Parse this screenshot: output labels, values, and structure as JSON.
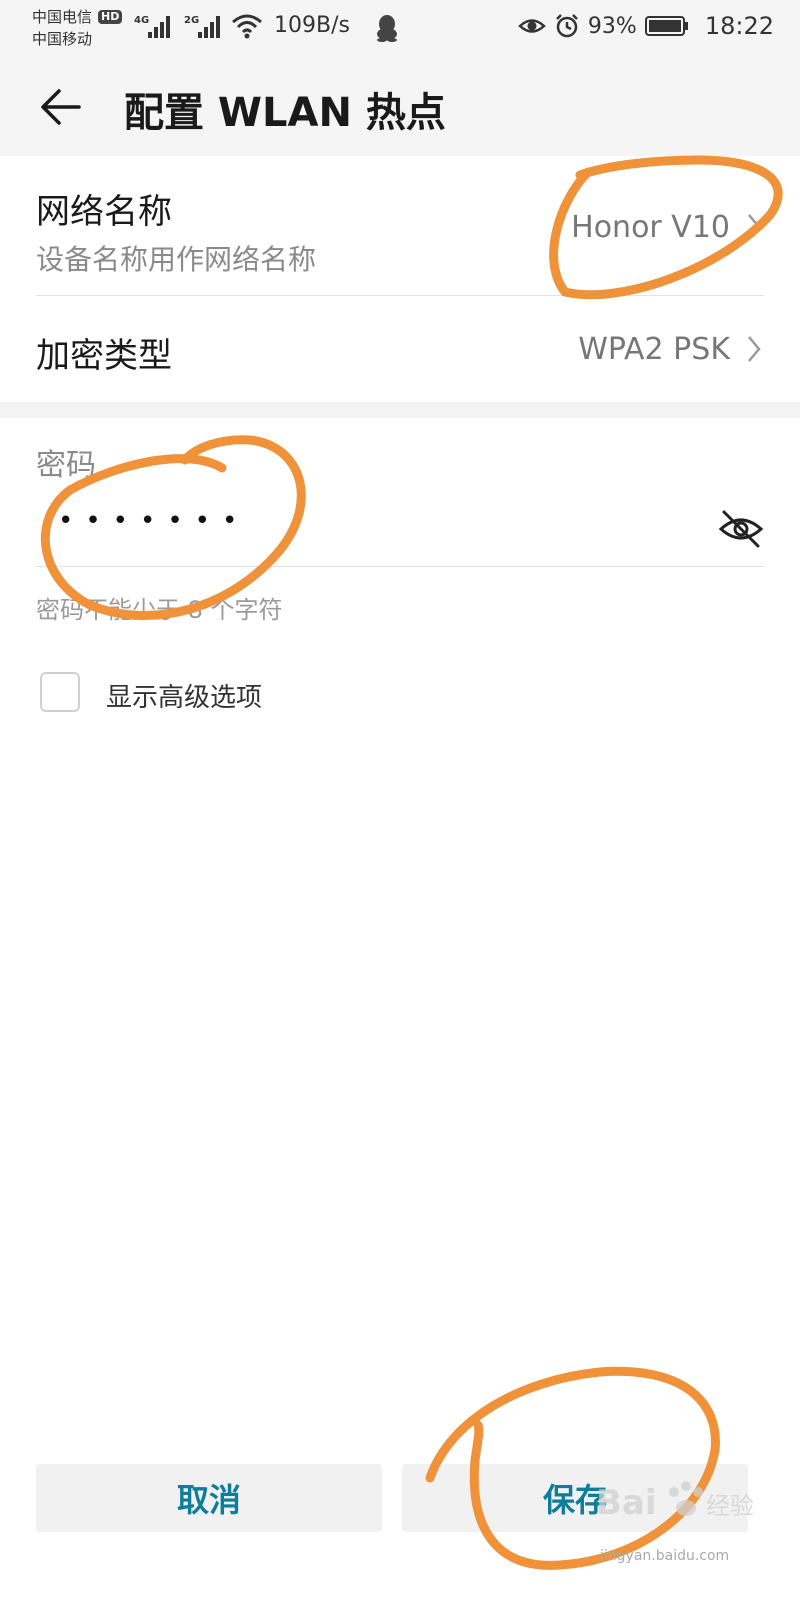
{
  "status_bar": {
    "carrier_1": "中国电信",
    "hd_badge": "HD",
    "carrier_2": "中国移动",
    "net_speed": "109B/s",
    "battery": "93%",
    "time": "18:22",
    "icons": [
      "signal-4g-icon",
      "signal-2g-icon",
      "wifi-icon",
      "qq-icon",
      "eye-icon",
      "alarm-icon",
      "battery-icon"
    ]
  },
  "toolbar": {
    "title": "配置 WLAN 热点"
  },
  "network_name": {
    "label": "网络名称",
    "subtitle": "设备名称用作网络名称",
    "value": "Honor V10"
  },
  "encryption": {
    "label": "加密类型",
    "value": "WPA2 PSK"
  },
  "password": {
    "label": "密码",
    "masked_value": "•••••••",
    "hint": "密码不能少于 8 个字符"
  },
  "advanced": {
    "label": "显示高级选项",
    "checked": false
  },
  "buttons": {
    "cancel": "取消",
    "save": "保存"
  },
  "watermark": {
    "text": "jingyan.baidu.com"
  },
  "colors": {
    "accent": "#0d7d9a",
    "annotation": "#f0923a"
  }
}
